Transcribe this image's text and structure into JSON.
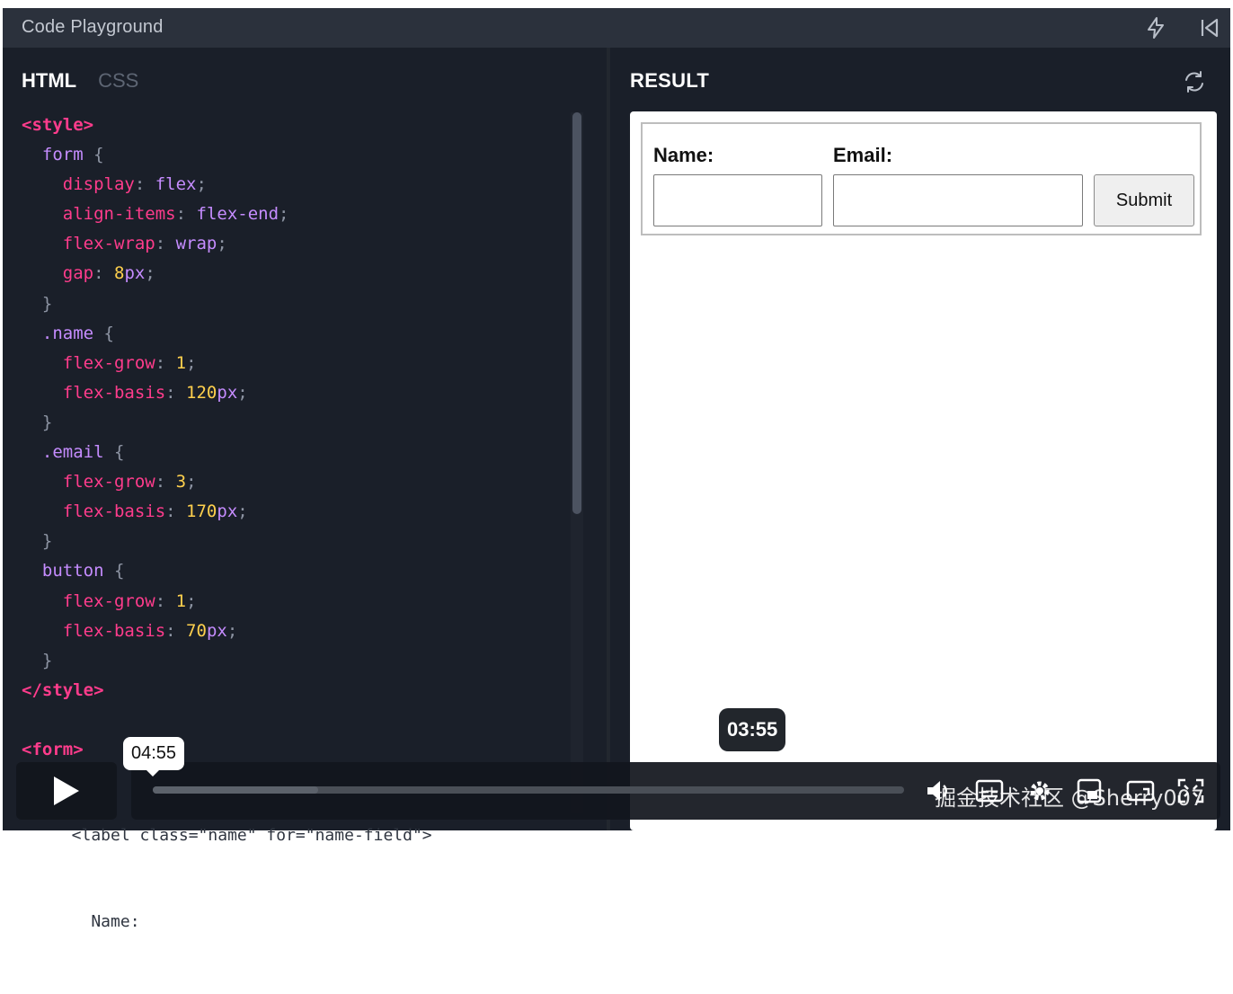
{
  "window": {
    "title": "Code Playground",
    "icons": [
      "lightning-icon",
      "collapse-left-icon"
    ]
  },
  "editor": {
    "tabs": [
      {
        "label": "HTML",
        "active": true
      },
      {
        "label": "CSS",
        "active": false
      }
    ],
    "code_lines": [
      "<style>",
      "  form {",
      "    display: flex;",
      "    align-items: flex-end;",
      "    flex-wrap: wrap;",
      "    gap: 8px;",
      "  }",
      "  .name {",
      "    flex-grow: 1;",
      "    flex-basis: 120px;",
      "  }",
      "  .email {",
      "    flex-grow: 3;",
      "    flex-basis: 170px;",
      "  }",
      "  button {",
      "    flex-grow: 1;",
      "    flex-basis: 70px;",
      "  }",
      "</style>",
      "",
      "<form>"
    ],
    "obscured_lines": [
      "  <label class=\"name\" for=\"name-field\">",
      "    Name:"
    ]
  },
  "result": {
    "label": "RESULT",
    "refresh_icon": "refresh-icon",
    "form": {
      "name_label": "Name:",
      "email_label": "Email:",
      "name_value": "",
      "email_value": "",
      "submit_label": "Submit"
    }
  },
  "video": {
    "hover_time": "04:55",
    "current_time": "03:55",
    "progress_fraction": 0.22,
    "watermark": "掘金技术社区 @Sherry007",
    "controls": [
      "volume-icon",
      "subtitles-icon",
      "settings-icon",
      "pip-icon",
      "theater-icon",
      "fullscreen-icon"
    ]
  }
}
